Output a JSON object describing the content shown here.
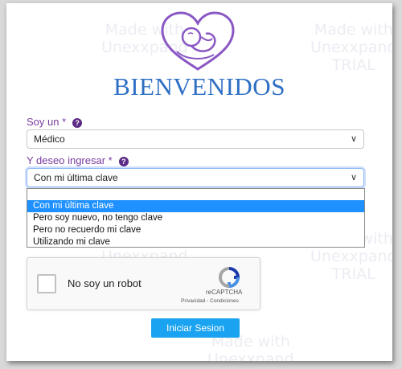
{
  "page": {
    "title": "BIENVENIDOS"
  },
  "colors": {
    "title": "#2e6fc4",
    "label": "#7a3ba0",
    "logo": "#8a58c4",
    "button": "#1aa3f0",
    "selected_option": "#1e90ff"
  },
  "watermark": {
    "line1": "Made with",
    "line2": "Unexxpand",
    "line3": "TRIAL"
  },
  "form": {
    "role_label": "Soy un *",
    "role_value": "Médico",
    "access_label": "Y deseo ingresar *",
    "access_value": "Con mi última clave",
    "access_options": [
      "Con mi última clave",
      "Pero soy nuevo, no tengo clave",
      "Pero no recuerdo mi clave",
      "Utilizando mi clave"
    ],
    "help_glyph": "?"
  },
  "captcha": {
    "label": "No soy un robot",
    "brand": "reCAPTCHA",
    "links": "Privacidad - Condiciones"
  },
  "login": {
    "button_label": "Iniciar Sesion"
  },
  "icons": {
    "help": "help-icon",
    "chevron": "chevron-down-icon",
    "logo": "baby-heart-logo-icon",
    "captcha": "recaptcha-logo-icon"
  }
}
